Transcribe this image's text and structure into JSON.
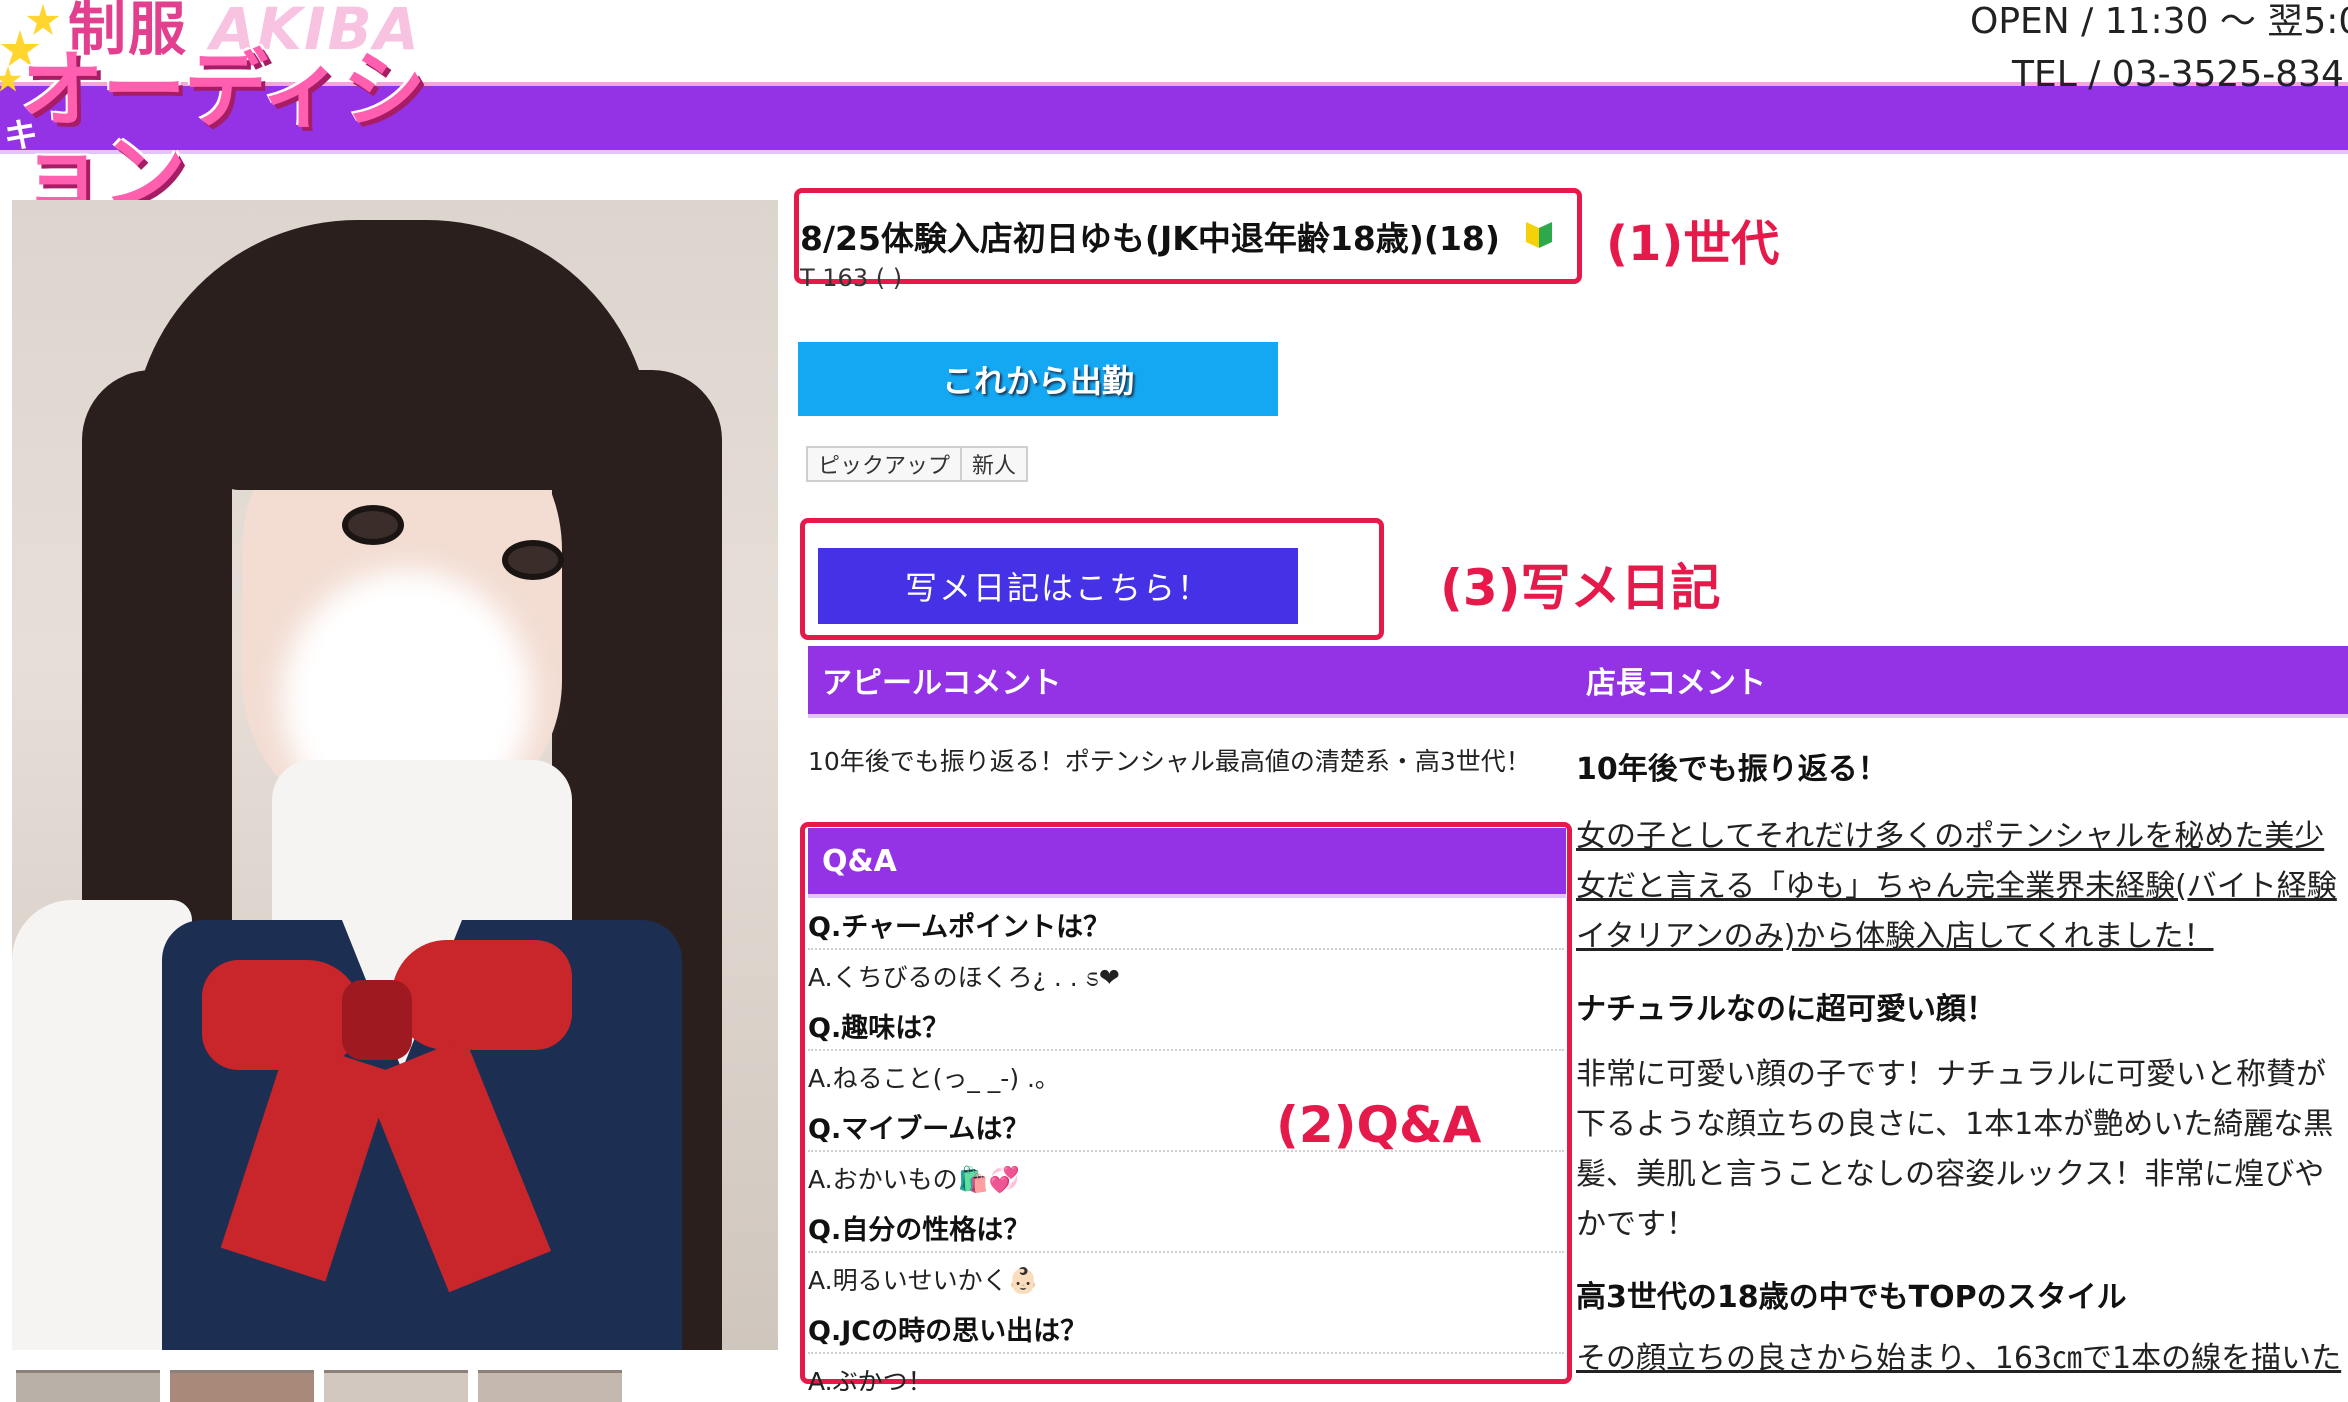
{
  "header": {
    "logo": {
      "line1": "制服",
      "line1_latin": "AKIBA",
      "line2": "オーディション",
      "side_char": "キ"
    },
    "open_hours": "OPEN / 11:30 〜 翌5:0",
    "phone": "TEL / 03-3525-834"
  },
  "profile": {
    "name": "8/25体験入店初日ゆも(JK中退年齢18歳)(18)",
    "size": "T 163 ( )",
    "shift_button": "これから出勤",
    "tags": [
      "ピックアップ",
      "新人"
    ],
    "diary_button": "写メ日記はこちら！"
  },
  "annotations": {
    "generation": "(1)世代",
    "qa": "(2)Q&A",
    "diary": "(3)写メ日記"
  },
  "appeal": {
    "heading": "アピールコメント",
    "text": "10年後でも振り返る！ポテンシャル最高値の清楚系・高3世代！"
  },
  "qa": {
    "heading": "Q&A",
    "items": [
      {
        "q": "Q.チャームポイントは？",
        "a": "A.くちびるのほくろ¿ . . ಽ❤"
      },
      {
        "q": "Q.趣味は？",
        "a": "A.ねること(っ_ _-) .｡"
      },
      {
        "q": "Q.マイブームは？",
        "a": "A.おかいもの🛍️💞"
      },
      {
        "q": "Q.自分の性格は？",
        "a": "A.明るいせいかく👶🏻"
      },
      {
        "q": "Q.JCの時の思い出は？",
        "a": "A.ぶかつ！"
      }
    ]
  },
  "manager": {
    "heading": "店長コメント",
    "h1": "10年後でも振り返る！",
    "p1": "女の子としてそれだけ多くのポテンシャルを秘めた美少女だと言える「ゆも」ちゃん完全業界未経験(バイト経験イタリアンのみ)から体験入店してくれました！",
    "h2": "ナチュラルなのに超可愛い顔！",
    "p2": "非常に可愛い顔の子です！ナチュラルに可愛いと称賛が下るような顔立ちの良さに、1本1本が艶めいた綺麗な黒髪、美肌と言うことなしの容姿ルックス！非常に煌びやかです！",
    "h3": "高3世代の18歳の中でもTOPのスタイル",
    "p3": "その顔立ちの良さから始まり、163㎝で1本の線を描いた"
  },
  "colors": {
    "brand_purple": "#9433e6",
    "shift_blue": "#14a8f3",
    "diary_indigo": "#4632e6",
    "annotation_red": "#e6194b"
  }
}
